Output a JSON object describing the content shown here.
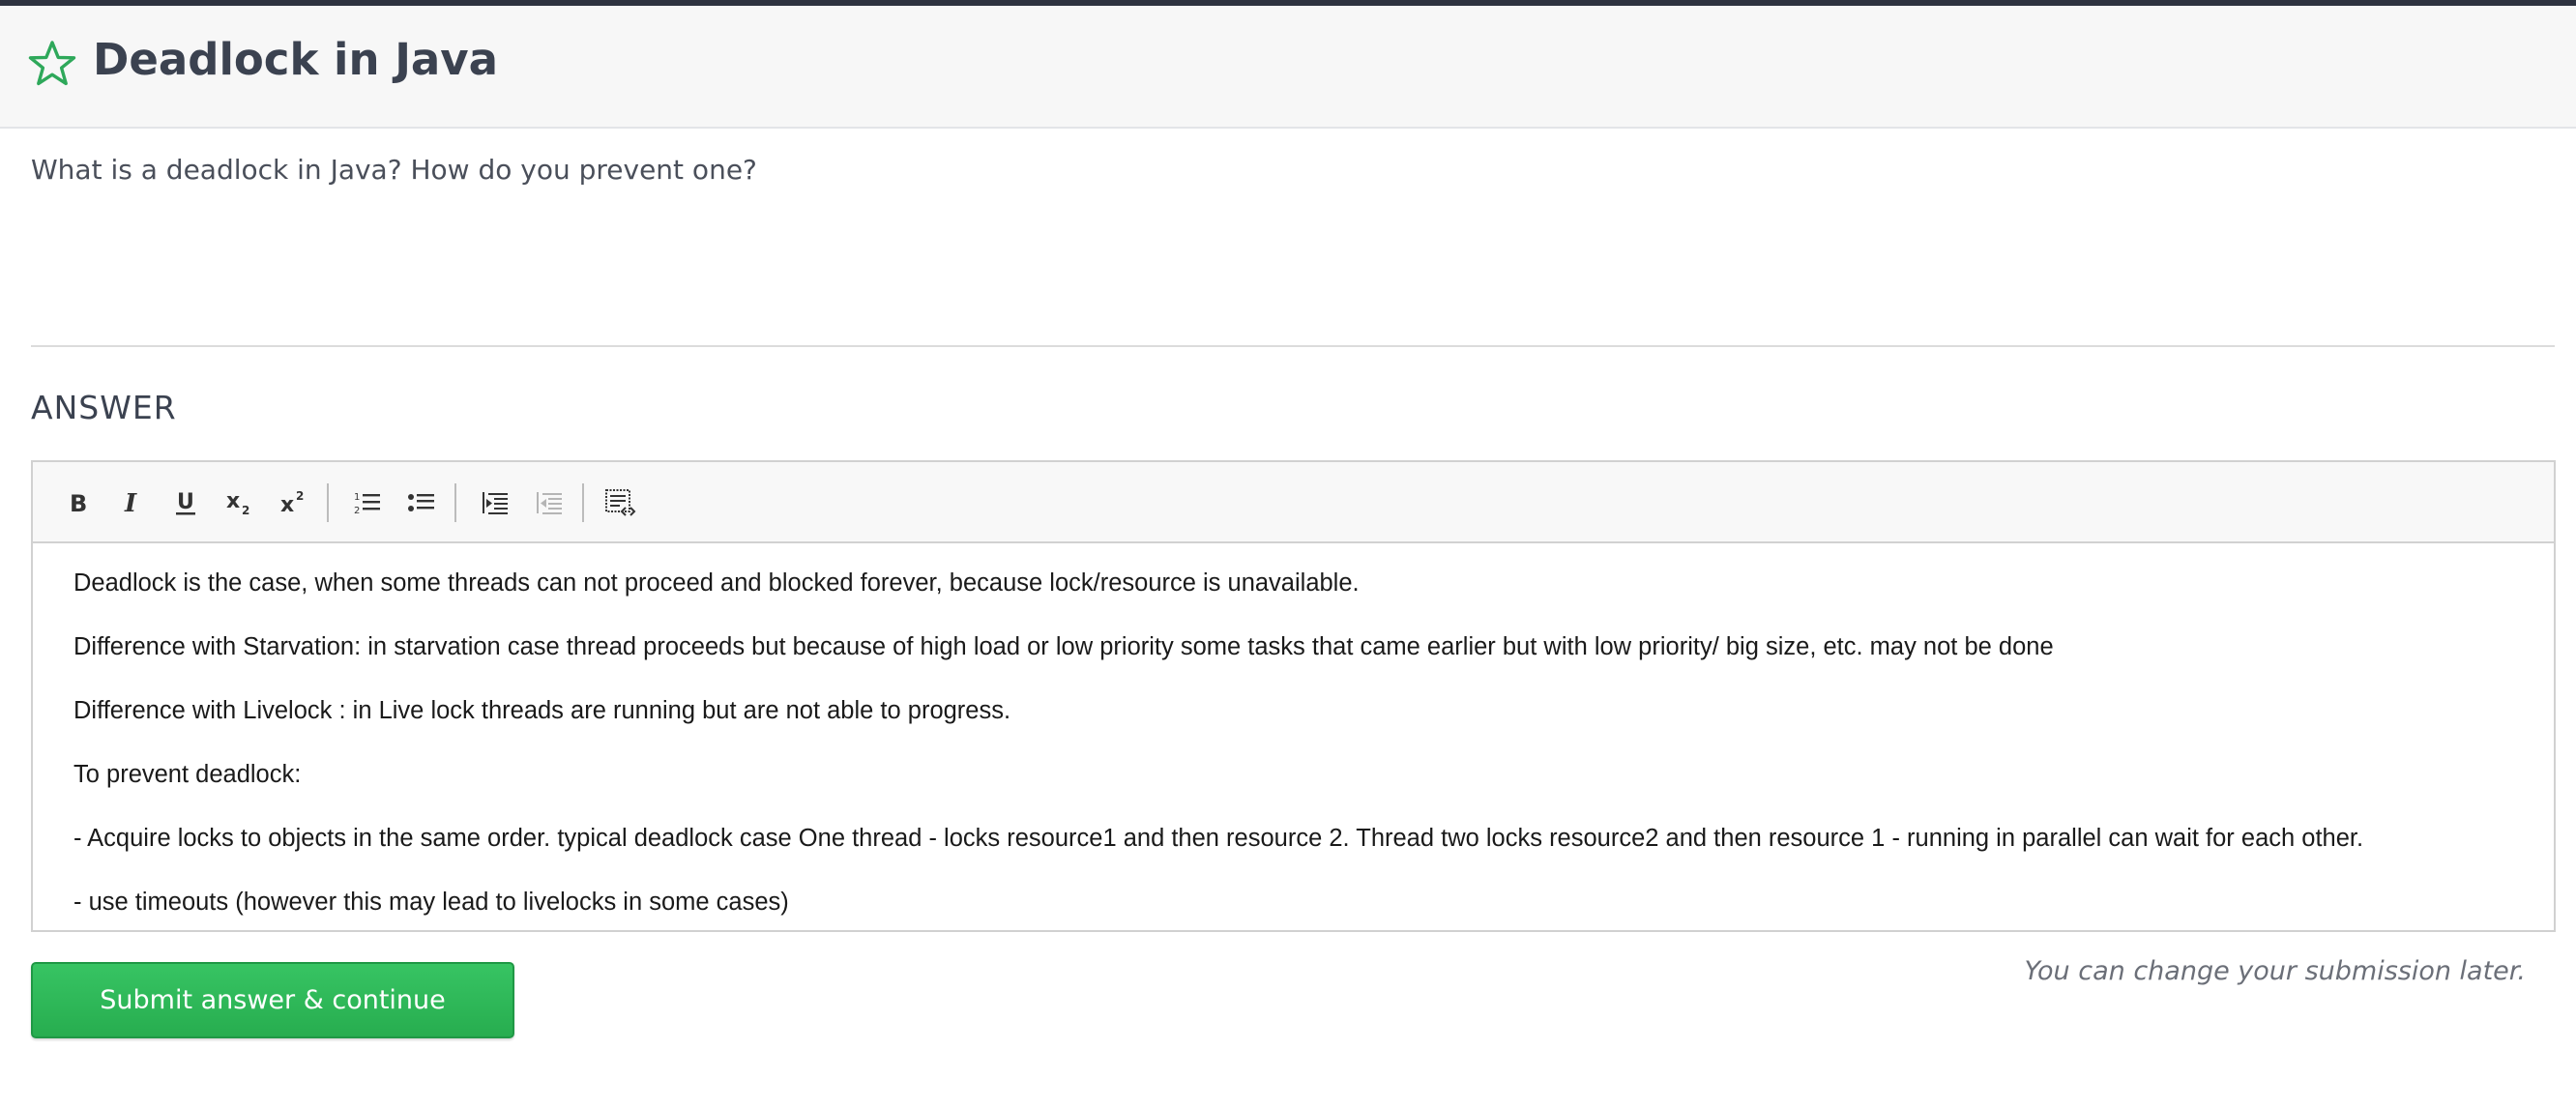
{
  "header": {
    "title": "Deadlock in Java",
    "star_icon": "star-outline-icon",
    "star_color": "#2ea85a"
  },
  "question": {
    "text": "What is a deadlock in Java? How do you prevent one?"
  },
  "answer": {
    "heading": "ANSWER",
    "toolbar": {
      "buttons": [
        {
          "name": "bold",
          "icon": "bold-icon"
        },
        {
          "name": "italic",
          "icon": "italic-icon"
        },
        {
          "name": "underline",
          "icon": "underline-icon"
        },
        {
          "name": "subscript",
          "icon": "subscript-icon"
        },
        {
          "name": "superscript",
          "icon": "superscript-icon"
        },
        {
          "name": "numbered-list",
          "icon": "numbered-list-icon"
        },
        {
          "name": "bulleted-list",
          "icon": "bulleted-list-icon"
        },
        {
          "name": "indent",
          "icon": "indent-icon"
        },
        {
          "name": "outdent",
          "icon": "outdent-icon",
          "disabled": true
        },
        {
          "name": "source",
          "icon": "source-code-icon"
        }
      ]
    },
    "paragraphs": [
      "Deadlock is the case, when some threads can not proceed and blocked forever, because lock/resource is unavailable.",
      "Difference with Starvation: in starvation case thread proceeds but because of high load or low priority some tasks that came earlier but with low priority/ big size, etc. may not be done",
      "Difference with Livelock : in Live lock threads are running but are not able to progress.",
      "To prevent deadlock:",
      "- Acquire locks to objects in the same order. typical deadlock case One thread - locks resource1 and then resource 2. Thread two locks resource2 and then resource 1 - running in parallel can wait for each other.",
      "- use timeouts (however this may lead to livelocks in some cases)"
    ]
  },
  "submit": {
    "label": "Submit answer & continue",
    "note": "You can change your submission later.",
    "button_color": "#2fbb58"
  }
}
